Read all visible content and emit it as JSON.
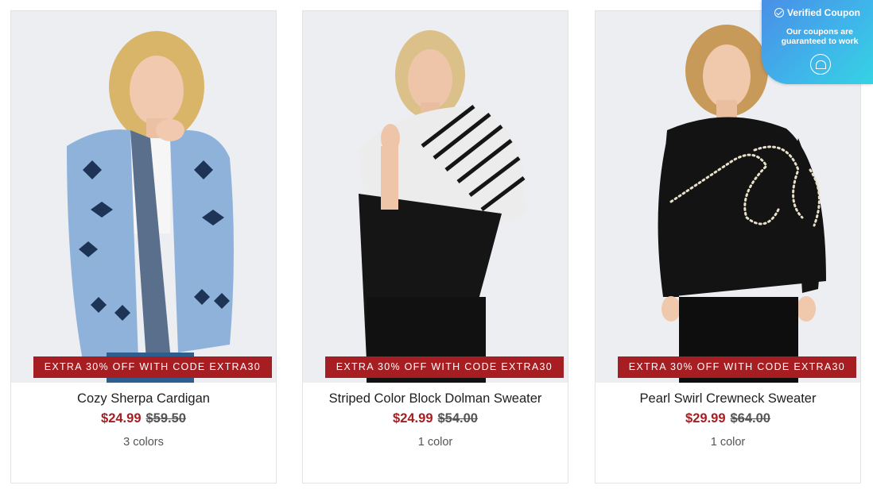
{
  "products": [
    {
      "title": "Cozy Sherpa Cardigan",
      "sale_price": "$24.99",
      "original_price": "$59.50",
      "colors_text": "3 colors",
      "promo": "EXTRA 30% OFF WITH CODE EXTRA30",
      "image_subject": "woman in light blue patterned cardigan"
    },
    {
      "title": "Striped Color Block Dolman Sweater",
      "sale_price": "$24.99",
      "original_price": "$54.00",
      "colors_text": "1 color",
      "promo": "EXTRA 30% OFF WITH CODE EXTRA30",
      "image_subject": "woman in black and white striped color block sweater"
    },
    {
      "title": "Pearl Swirl Crewneck Sweater",
      "sale_price": "$29.99",
      "original_price": "$64.00",
      "colors_text": "1 color",
      "promo": "EXTRA 30% OFF WITH CODE EXTRA30",
      "image_subject": "woman in black sweater with pearl swirl embellishment"
    }
  ],
  "coupon_widget": {
    "title": "Verified Coupon",
    "subtitle": "Our coupons are guaranteed to work",
    "icon": "check-circle-icon",
    "logo_icon": "brand-logo-icon"
  },
  "colors": {
    "sale_red": "#a61e22",
    "badge_red": "#a61e22",
    "text_dark": "#1e1e1e",
    "text_muted": "#555555",
    "widget_gradient_start": "#4a8fe6",
    "widget_gradient_end": "#35d3e4"
  }
}
